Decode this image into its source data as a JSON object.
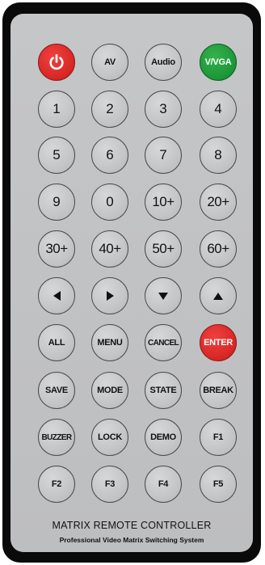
{
  "buttons": {
    "power": "power-icon",
    "av": "AV",
    "audio": "Audio",
    "vvga": "V/VGA",
    "n1": "1",
    "n2": "2",
    "n3": "3",
    "n4": "4",
    "n5": "5",
    "n6": "6",
    "n7": "7",
    "n8": "8",
    "n9": "9",
    "n0": "0",
    "p10": "10+",
    "p20": "20+",
    "p30": "30+",
    "p40": "40+",
    "p50": "50+",
    "p60": "60+",
    "left": "left-arrow-icon",
    "right": "right-arrow-icon",
    "down": "down-arrow-icon",
    "up": "up-arrow-icon",
    "all": "ALL",
    "menu": "MENU",
    "cancel": "CANCEL",
    "enter": "ENTER",
    "save": "SAVE",
    "mode": "MODE",
    "state": "STATE",
    "break": "BREAK",
    "buzzer": "BUZZER",
    "lock": "LOCK",
    "demo": "DEMO",
    "f1": "F1",
    "f2": "F2",
    "f3": "F3",
    "f4": "F4",
    "f5": "F5"
  },
  "footer": {
    "title": "MATRIX REMOTE CONTROLLER",
    "subtitle": "Professional Video Matrix Switching System"
  },
  "colors": {
    "body": "#0a0a0a",
    "panel": "#c3c4c6",
    "red": "#db2a27",
    "green": "#1f9a3a"
  }
}
